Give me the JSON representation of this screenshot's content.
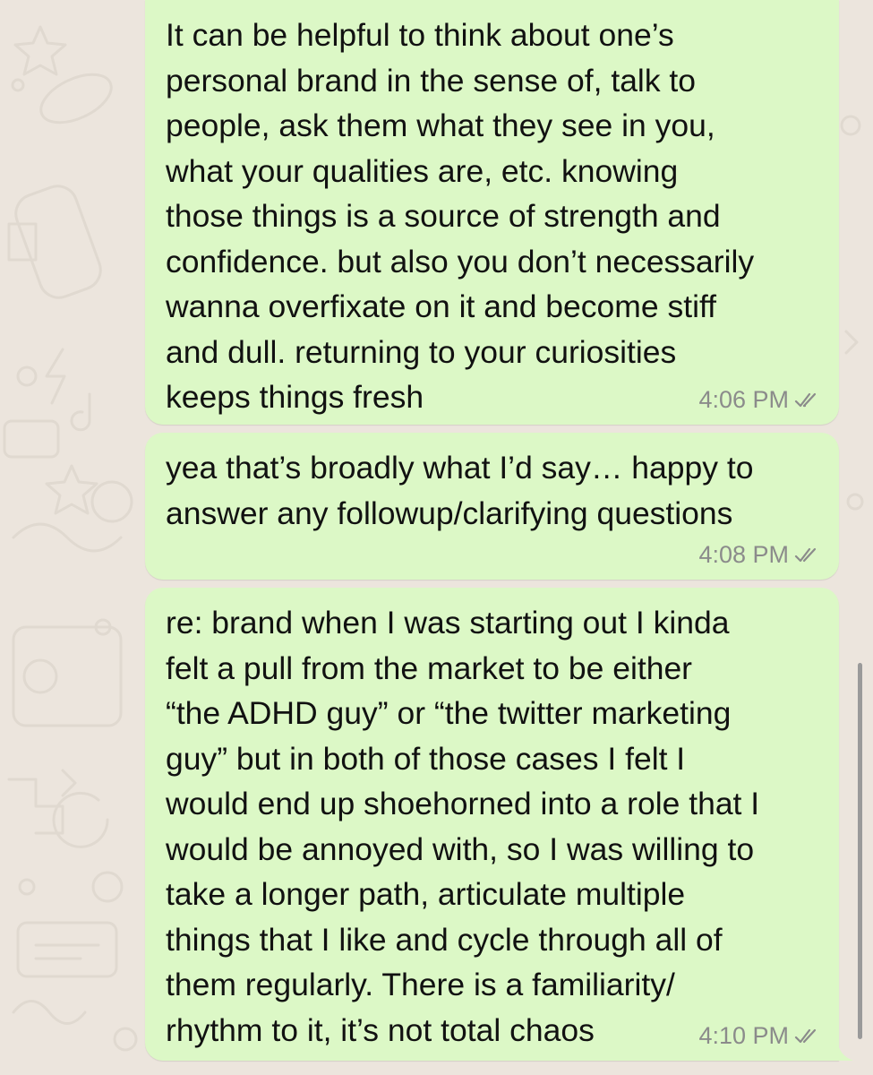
{
  "messages": [
    {
      "text": "It can be helpful to think about one’s\npersonal brand in the sense of, talk to\npeople, ask them what they see in you,\nwhat your qualities are, etc. knowing\nthose things is a source of strength and\nconfidence. but also you don’t necessarily\nwanna overfixate on it and become stiff\nand dull. returning to your curiosities\nkeeps things fresh",
      "time": "4:06 PM",
      "status_icon": "double-check-icon"
    },
    {
      "text": "yea that’s broadly what I’d say… happy to\nanswer any followup/clarifying questions",
      "time": "4:08 PM",
      "status_icon": "double-check-icon"
    },
    {
      "text": "re: brand when I was starting out I kinda\nfelt a pull from the market to be either\n“the ADHD guy” or “the twitter marketing\nguy” but in both of those cases I felt I\nwould end up shoehorned into a role that I\nwould be annoyed with, so I was willing to\ntake a longer path, articulate multiple\nthings that I like and cycle through all of\nthem regularly. There is a familiarity/\nrhythm to it, it’s not total chaos",
      "time": "4:10 PM",
      "status_icon": "double-check-icon"
    }
  ],
  "colors": {
    "chat_background": "#ece5dd",
    "outgoing_bubble": "#dcf8c6",
    "timestamp": "#8b8b8b"
  }
}
